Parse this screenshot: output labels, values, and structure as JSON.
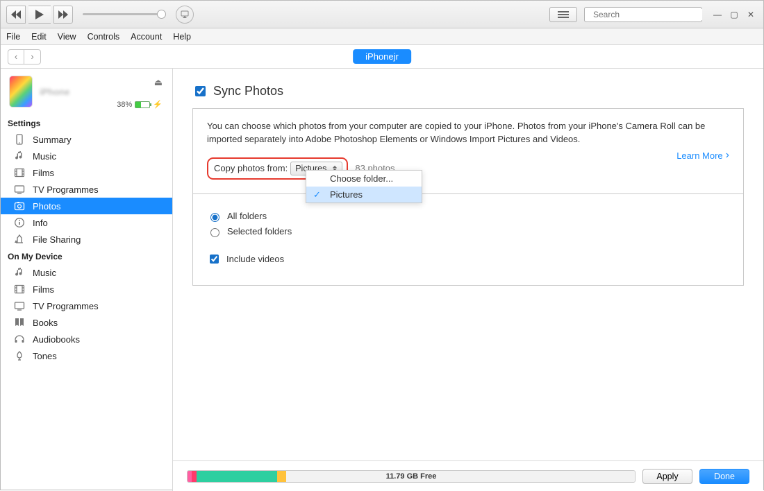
{
  "menubar": [
    "File",
    "Edit",
    "View",
    "Controls",
    "Account",
    "Help"
  ],
  "search": {
    "placeholder": "Search"
  },
  "device_pill": "iPhonejr",
  "device": {
    "name": "iPhone",
    "model": "",
    "battery_text": "38%"
  },
  "sidebar": {
    "settings_title": "Settings",
    "settings_items": [
      {
        "icon": "summary",
        "label": "Summary"
      },
      {
        "icon": "music",
        "label": "Music"
      },
      {
        "icon": "film",
        "label": "Films"
      },
      {
        "icon": "tv",
        "label": "TV Programmes"
      },
      {
        "icon": "photos",
        "label": "Photos",
        "selected": true
      },
      {
        "icon": "info",
        "label": "Info"
      },
      {
        "icon": "fileshare",
        "label": "File Sharing"
      }
    ],
    "ondevice_title": "On My Device",
    "ondevice_items": [
      {
        "icon": "music",
        "label": "Music"
      },
      {
        "icon": "film",
        "label": "Films"
      },
      {
        "icon": "tv",
        "label": "TV Programmes"
      },
      {
        "icon": "books",
        "label": "Books"
      },
      {
        "icon": "audiobooks",
        "label": "Audiobooks"
      },
      {
        "icon": "tones",
        "label": "Tones"
      }
    ]
  },
  "content": {
    "section_title": "Sync Photos",
    "intro": "You can choose which photos from your computer are copied to your iPhone. Photos from your iPhone's Camera Roll can be imported separately into Adobe Photoshop Elements or Windows Import Pictures and Videos.",
    "copy_label": "Copy photos from:",
    "dropdown_value": "Pictures",
    "photo_count": "83 photos",
    "learn_more": "Learn More",
    "menu_items": [
      {
        "label": "Choose folder...",
        "selected": false
      },
      {
        "label": "Pictures",
        "selected": true
      }
    ],
    "radio_all": "All folders",
    "radio_selected": "Selected folders",
    "include_videos": "Include videos"
  },
  "bottom": {
    "free_label": "11.79 GB Free",
    "apply": "Apply",
    "done": "Done",
    "segments": [
      {
        "color": "#ff5fa2",
        "pct": 1
      },
      {
        "color": "#ff3b6b",
        "pct": 1
      },
      {
        "color": "#2ecfa0",
        "pct": 18
      },
      {
        "color": "#ffc23c",
        "pct": 2
      },
      {
        "color": "#f2f2f2",
        "pct": 78
      }
    ]
  }
}
